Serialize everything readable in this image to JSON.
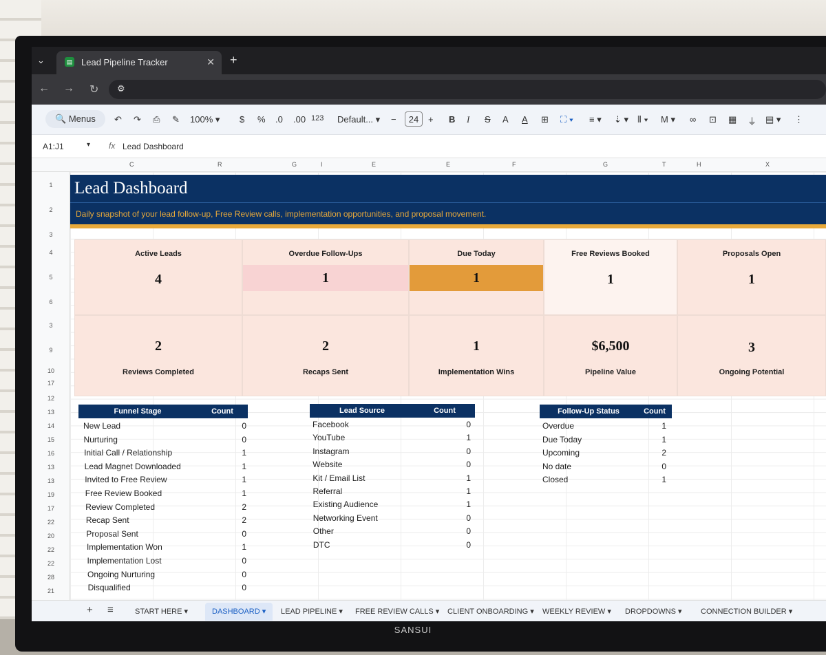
{
  "browser": {
    "tab_title": "Lead Pipeline Tracker",
    "close": "✕",
    "new_tab": "+"
  },
  "toolbar": {
    "menus": "Menus",
    "zoom": "100%",
    "currency": "$",
    "percent": "%",
    "decimal_decrease": ".0",
    "decimal_increase": ".00",
    "number_format": "123",
    "font": "Default...",
    "font_size": "24",
    "bold": "B",
    "italic": "I",
    "text_color": "A"
  },
  "formula_bar": {
    "cell_ref": "A1:J1",
    "fx": "fx",
    "value": "Lead Dashboard"
  },
  "columns": [
    "C",
    "R",
    "G",
    "I",
    "E",
    "E",
    "F",
    "G",
    "T",
    "H",
    "X"
  ],
  "rows": [
    "1",
    "2",
    "3",
    "4",
    "5",
    "6",
    "3",
    "9",
    "10",
    "17",
    "12",
    "13",
    "14",
    "15",
    "16",
    "13",
    "13",
    "19",
    "17",
    "22",
    "20",
    "22",
    "22",
    "28",
    "21"
  ],
  "dashboard": {
    "title": "Lead Dashboard",
    "subtitle": "Daily snapshot of your lead follow-up, Free Review calls, implementation opportunities, and proposal movement.",
    "colors": {
      "navy": "#0b3163",
      "gold": "#e8a93a",
      "overdue": "#f8d3d3",
      "due": "#e39b3a",
      "panel": "#fbe6de"
    },
    "kpis_row1": [
      {
        "label": "Active Leads",
        "value": "4"
      },
      {
        "label": "Overdue Follow-Ups",
        "value": "1"
      },
      {
        "label": "Due Today",
        "value": "1"
      },
      {
        "label": "Free Reviews Booked",
        "value": "1"
      },
      {
        "label": "Proposals Open",
        "value": "1"
      }
    ],
    "kpis_row2": [
      {
        "label": "Reviews Completed",
        "value": "2"
      },
      {
        "label": "Recaps Sent",
        "value": "2"
      },
      {
        "label": "Implementation Wins",
        "value": "1"
      },
      {
        "label": "Pipeline Value",
        "value": "$6,500"
      },
      {
        "label": "Ongoing Potential",
        "value": "3"
      }
    ]
  },
  "funnel": {
    "header": "Funnel Stage",
    "count_header": "Count",
    "rows": [
      {
        "label": "New Lead",
        "count": "0"
      },
      {
        "label": "Nurturing",
        "count": "0"
      },
      {
        "label": "Initial Call / Relationship",
        "count": "1"
      },
      {
        "label": "Lead Magnet Downloaded",
        "count": "1"
      },
      {
        "label": "Invited to Free Review",
        "count": "1"
      },
      {
        "label": "Free Review Booked",
        "count": "1"
      },
      {
        "label": "Review Completed",
        "count": "2"
      },
      {
        "label": "Recap Sent",
        "count": "2"
      },
      {
        "label": "Proposal Sent",
        "count": "0"
      },
      {
        "label": "Implementation Won",
        "count": "1"
      },
      {
        "label": "Implementation Lost",
        "count": "0"
      },
      {
        "label": "Ongoing Nurturing",
        "count": "0"
      },
      {
        "label": "Disqualified",
        "count": "0"
      }
    ]
  },
  "sources": {
    "header": "Lead Source",
    "count_header": "Count",
    "rows": [
      {
        "label": "Facebook",
        "count": "0"
      },
      {
        "label": "YouTube",
        "count": "1"
      },
      {
        "label": "Instagram",
        "count": "0"
      },
      {
        "label": "Website",
        "count": "0"
      },
      {
        "label": "Kit / Email List",
        "count": "1"
      },
      {
        "label": "Referral",
        "count": "1"
      },
      {
        "label": "Existing Audience",
        "count": "1"
      },
      {
        "label": "Networking Event",
        "count": "0"
      },
      {
        "label": "Other",
        "count": "0"
      },
      {
        "label": "DTC",
        "count": "0"
      }
    ]
  },
  "followup": {
    "header": "Follow-Up Status",
    "count_header": "Count",
    "rows": [
      {
        "label": "Overdue",
        "count": "1"
      },
      {
        "label": "Due Today",
        "count": "1"
      },
      {
        "label": "Upcoming",
        "count": "2"
      },
      {
        "label": "No date",
        "count": "0"
      },
      {
        "label": "Closed",
        "count": "1"
      }
    ]
  },
  "sheet_tabs": {
    "add": "+",
    "list": "≡",
    "tabs": [
      "START HERE",
      "DASHBOARD",
      "LEAD PIPELINE",
      "FREE REVIEW CALLS",
      "CLIENT ONBOARDING",
      "WEEKLY REVIEW",
      "DROPDOWNS",
      "CONNECTION BUILDER"
    ],
    "active": "DASHBOARD"
  },
  "monitor_brand": "SANSUI"
}
